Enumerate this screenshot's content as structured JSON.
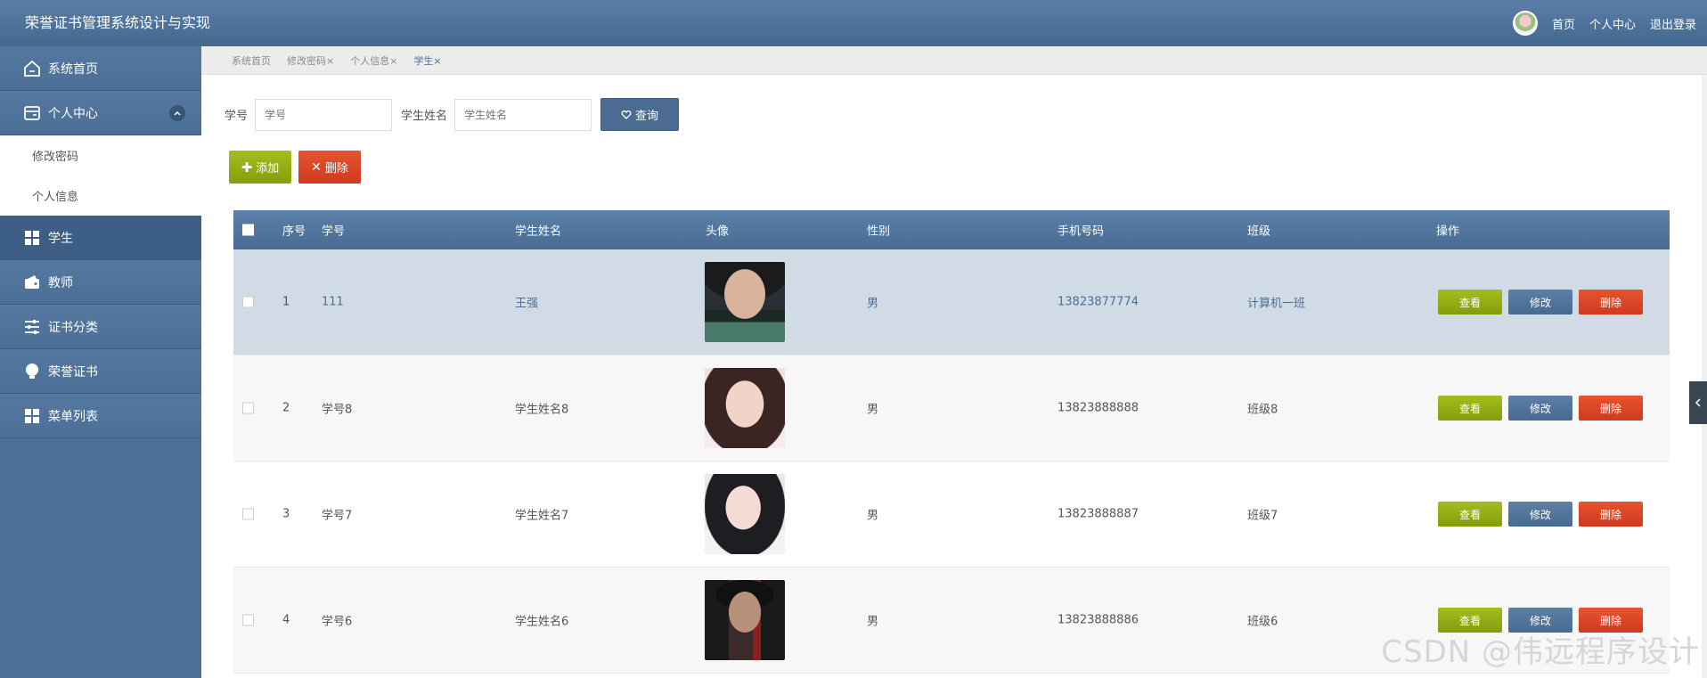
{
  "app": {
    "title": "荣誉证书管理系统设计与实现"
  },
  "topnav": {
    "home": "首页",
    "profile": "个人中心",
    "logout": "退出登录"
  },
  "sidebar": {
    "items": [
      {
        "label": "系统首页",
        "icon": "home-icon"
      },
      {
        "label": "个人中心",
        "icon": "card-icon"
      },
      {
        "label": "学生",
        "icon": "grid-icon"
      },
      {
        "label": "教师",
        "icon": "wallet-icon"
      },
      {
        "label": "证书分类",
        "icon": "sliders-icon"
      },
      {
        "label": "荣誉证书",
        "icon": "bulb-icon"
      },
      {
        "label": "菜单列表",
        "icon": "grid-icon"
      }
    ],
    "sub_items": [
      "修改密码",
      "个人信息"
    ]
  },
  "tabs": [
    "系统首页",
    "修改密码×",
    "个人信息×",
    "学生×"
  ],
  "search": {
    "id_label": "学号",
    "id_placeholder": "学号",
    "name_label": "学生姓名",
    "name_placeholder": "学生姓名",
    "query_label": "查询"
  },
  "actions": {
    "add_label": "添加",
    "delete_label": "删除"
  },
  "table": {
    "headers": [
      "序号",
      "学号",
      "学生姓名",
      "头像",
      "性别",
      "手机号码",
      "班级",
      "操作"
    ],
    "rows": [
      {
        "idx": "1",
        "sid": "111",
        "name": "王强",
        "gender": "男",
        "phone": "13823877774",
        "cls": "计算机一班"
      },
      {
        "idx": "2",
        "sid": "学号8",
        "name": "学生姓名8",
        "gender": "男",
        "phone": "13823888888",
        "cls": "班级8"
      },
      {
        "idx": "3",
        "sid": "学号7",
        "name": "学生姓名7",
        "gender": "男",
        "phone": "13823888887",
        "cls": "班级7"
      },
      {
        "idx": "4",
        "sid": "学号6",
        "name": "学生姓名6",
        "gender": "男",
        "phone": "13823888886",
        "cls": "班级6"
      }
    ],
    "ops": {
      "view": "查看",
      "edit": "修改",
      "del": "删除"
    }
  },
  "watermark": "CSDN @伟远程序设计"
}
